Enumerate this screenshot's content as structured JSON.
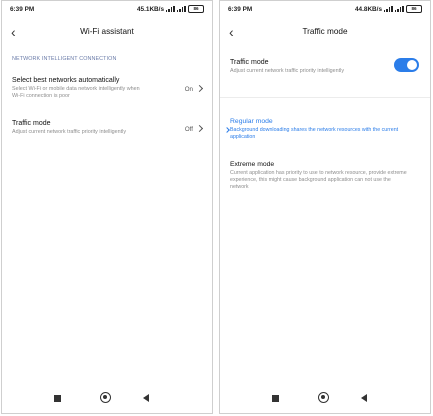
{
  "left_screen": {
    "status": {
      "time": "6:39 PM",
      "speed": "45.1KB/s",
      "battery": "86"
    },
    "header": {
      "back_glyph": "‹",
      "title": "Wi-Fi assistant"
    },
    "section_label": "NETWORK INTELLIGENT CONNECTION",
    "items": [
      {
        "title": "Select best networks automatically",
        "desc": "Select Wi-Fi or mobile data network intelligently when Wi-Fi connection is poor",
        "value": "On"
      },
      {
        "title": "Traffic mode",
        "desc": "Adjust current network traffic priority intelligently",
        "value": "Off"
      }
    ]
  },
  "right_screen": {
    "status": {
      "time": "6:39 PM",
      "speed": "44.8KB/s",
      "battery": "86"
    },
    "header": {
      "back_glyph": "‹",
      "title": "Traffic mode"
    },
    "traffic_item": {
      "title": "Traffic mode",
      "desc": "Adjust current network traffic priority intelligently",
      "enabled": true
    },
    "modes": [
      {
        "title": "Regular mode",
        "desc": "Background downloading shares the network resources with the current application",
        "selected": true
      },
      {
        "title": "Extreme mode",
        "desc": "Current application has priority to use to network resource, provide extreme experience, this might cause background application can not use the network",
        "selected": false
      }
    ]
  },
  "colors": {
    "accent": "#2b7de9",
    "section": "#6a7ba8",
    "muted": "#8e8e8e"
  },
  "icons": [
    "back-icon",
    "signal-icon",
    "battery-icon",
    "chevron-right-icon",
    "recents-icon",
    "home-icon",
    "nav-back-icon"
  ]
}
